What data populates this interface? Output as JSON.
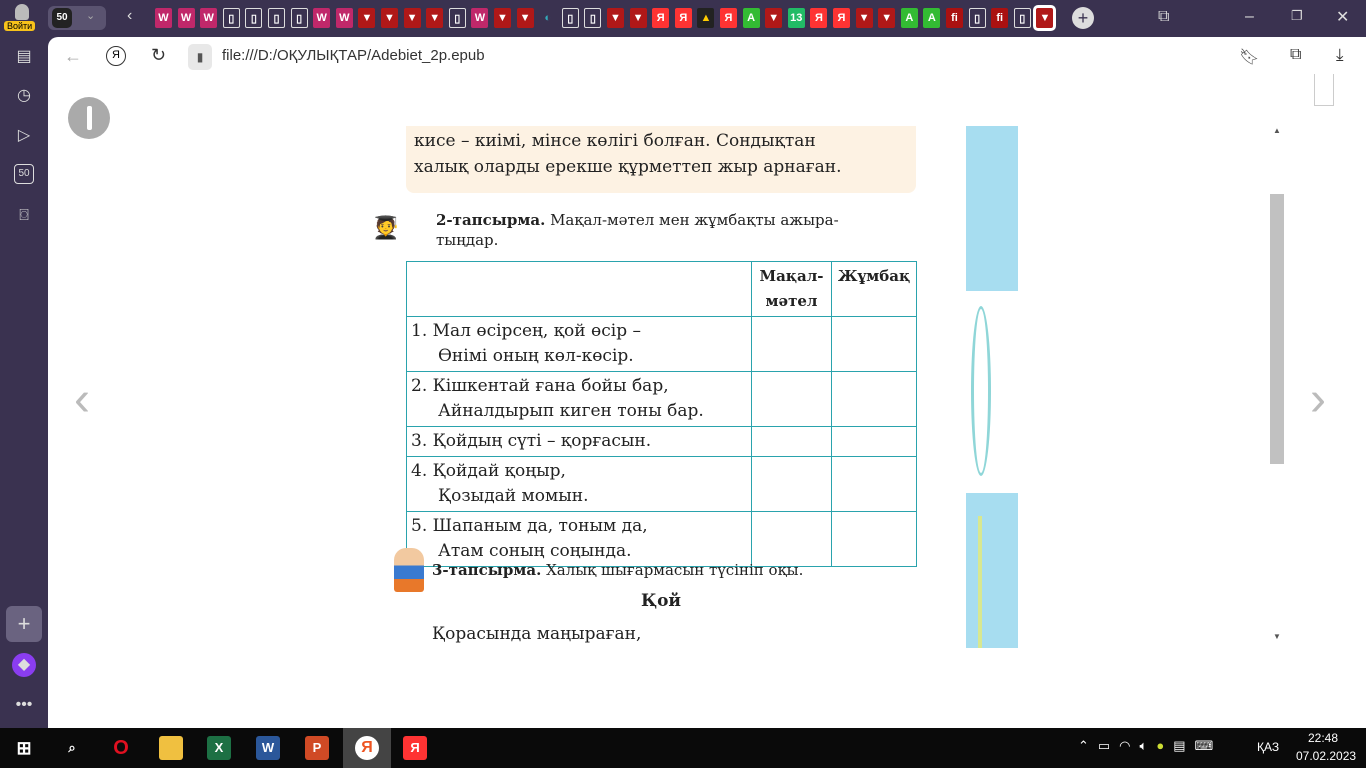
{
  "browser": {
    "login_label": "Войти",
    "tab_count": "50",
    "url": "file:///D:/ОҚУЛЫҚТАР/Adebiet_2p.epub",
    "tabs": [
      "w",
      "w",
      "w",
      "doc",
      "doc",
      "doc",
      "doc",
      "w",
      "w",
      "pdf",
      "pdf",
      "pdf",
      "pdf",
      "doc",
      "w",
      "pdf",
      "pdf",
      "globe",
      "doc",
      "doc",
      "pdf",
      "pdf",
      "ya",
      "ya",
      "img",
      "ya",
      "a",
      "pdf",
      "13",
      "ya",
      "ya",
      "pdf",
      "pdf",
      "a",
      "a",
      "fi",
      "doc",
      "fi",
      "doc",
      "pdf"
    ],
    "tab_glyphs": {
      "w": "W",
      "doc": "▯",
      "pdf": "▼",
      "globe": "◐",
      "ya": "Я",
      "img": "▲",
      "a": "A",
      "13": "13",
      "fi": "fi"
    }
  },
  "page": {
    "intro_lines": [
      "кисе – киімі, мінсе көлігі болған. Сондықтан",
      "халық оларды ерекше құрметтеп жыр арнаған."
    ],
    "task2": {
      "label": "2-тапсырма.",
      "text": "Мақал-мәтел мен жұмбақты ажыра-",
      "text2": "тыңдар."
    },
    "table": {
      "headers": [
        "",
        "Мақал-мәтел",
        "Жұмбақ"
      ],
      "rows": [
        [
          "1. Мал өсірсең, қой өсір –",
          "Өнімі оның көл-көсір."
        ],
        [
          "2. Кішкентай ғана бойы бар,",
          "Айналдырып киген тоны бар."
        ],
        [
          "3. Қойдың сүті – қорғасын.",
          ""
        ],
        [
          "4. Қойдай қоңыр,",
          "Қозыдай момын."
        ],
        [
          "5. Шапаным да, тоным да,",
          "Атам соның соңында."
        ]
      ]
    },
    "task3": {
      "label": "3-тапсырма.",
      "text": "Халық шығармасын түсініп оқы."
    },
    "poem_title": "Қой",
    "poem_line": "Қорасында маңыраған,"
  },
  "clock": {
    "time": "22:48",
    "date": "07.02.2023",
    "lang": "ҚАЗ"
  }
}
